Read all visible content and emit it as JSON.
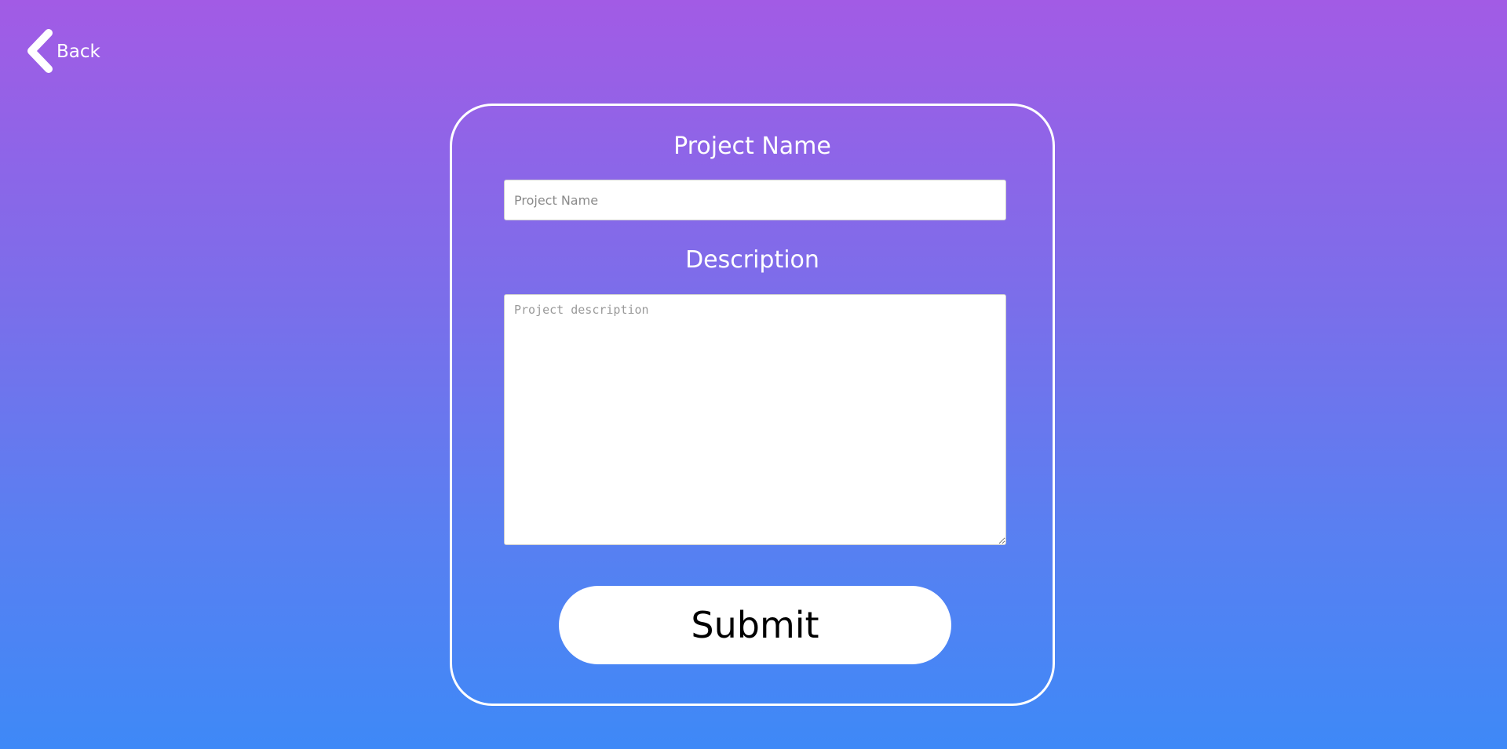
{
  "nav": {
    "back_label": "Back",
    "back_icon": "chevron-left-icon"
  },
  "form": {
    "name_label": "Project Name",
    "name_placeholder": "Project Name",
    "name_value": "",
    "description_label": "Description",
    "description_placeholder": "Project description",
    "description_value": "",
    "submit_label": "Submit"
  },
  "colors": {
    "gradient_top": "#a25be5",
    "gradient_bottom": "#3e89f7",
    "card_border": "#ffffff",
    "button_bg": "#ffffff",
    "button_text": "#000000"
  }
}
